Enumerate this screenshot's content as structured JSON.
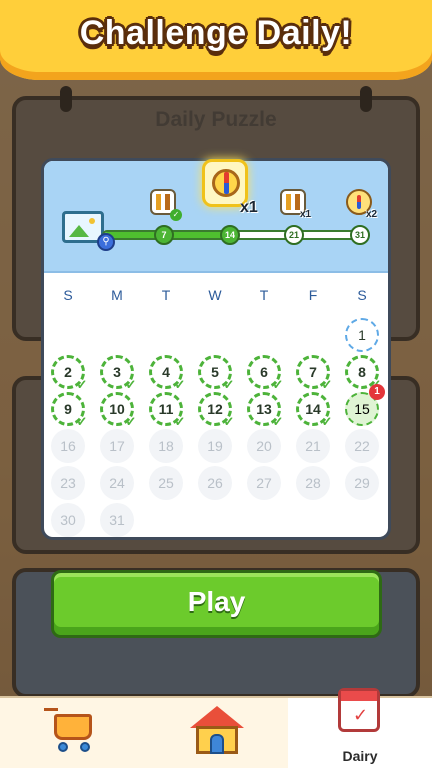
{
  "header": {
    "title": "Challenge Daily!"
  },
  "background": {
    "title": "Daily Puzzle"
  },
  "calendar": {
    "weekdays": [
      "S",
      "M",
      "T",
      "W",
      "T",
      "F",
      "S"
    ],
    "progress": {
      "milestones": [
        "7",
        "14",
        "21",
        "31"
      ],
      "reached_count": 2,
      "rewards": [
        {
          "icon": "hint-bars-icon",
          "multiplier": ""
        },
        {
          "icon": "compass-icon",
          "multiplier": "x1"
        },
        {
          "icon": "hint-bars-icon",
          "multiplier": "x1"
        },
        {
          "icon": "compass-icon",
          "multiplier": "x2"
        }
      ]
    },
    "days": [
      "1",
      "2",
      "3",
      "4",
      "5",
      "6",
      "7",
      "8",
      "9",
      "10",
      "11",
      "12",
      "13",
      "14",
      "15",
      "16",
      "17",
      "18",
      "19",
      "20",
      "21",
      "22",
      "23",
      "24",
      "25",
      "26",
      "27",
      "28",
      "29",
      "30",
      "31"
    ],
    "completed_days": [
      2,
      3,
      4,
      5,
      6,
      7,
      8,
      9,
      10,
      11,
      12,
      13,
      14
    ],
    "current_day": 15,
    "current_day_badge": "1"
  },
  "play_button": {
    "label": "Play"
  },
  "nav": {
    "items": [
      {
        "icon": "shopping-cart-icon",
        "label": ""
      },
      {
        "icon": "home-icon",
        "label": ""
      },
      {
        "icon": "calendar-icon",
        "label": "Dairy"
      }
    ]
  },
  "colors": {
    "accent_green": "#6ccb2c",
    "header_yellow": "#ffcf3a",
    "modal_header_blue": "#a9d4f5",
    "badge_red": "#e4353a"
  }
}
